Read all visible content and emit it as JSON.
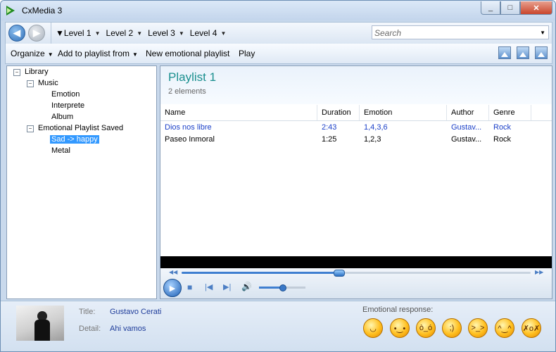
{
  "window": {
    "title": "CxMedia 3",
    "minimize": "_",
    "maximize": "□",
    "close": "✕"
  },
  "nav": {
    "back_icon": "◀",
    "forward_icon": "▶",
    "crumbs": [
      "Level 1",
      "Level 2",
      "Level 3",
      "Level 4"
    ],
    "search_placeholder": "Search"
  },
  "toolbar": {
    "organize": "Organize",
    "add_playlist": "Add to playlist from",
    "new_emotional": "New emotional playlist",
    "play": "Play"
  },
  "tree": {
    "library": "Library",
    "music": "Music",
    "emotion": "Emotion",
    "interprete": "Interprete",
    "album": "Album",
    "emotional_saved": "Emotional Playlist Saved",
    "sad_happy": "Sad -> happy",
    "metal": "Metal"
  },
  "playlist": {
    "title": "Playlist 1",
    "subtitle": "2 elements",
    "columns": [
      "Name",
      "Duration",
      "Emotion",
      "Author",
      "Genre"
    ],
    "rows": [
      {
        "name": "Dios nos libre",
        "duration": "2:43",
        "emotion": "1,4,3,6",
        "author": "Gustav...",
        "genre": "Rock"
      },
      {
        "name": "Paseo Inmoral",
        "duration": "1:25",
        "emotion": "1,2,3",
        "author": "Gustav...",
        "genre": "Rock"
      }
    ]
  },
  "player": {
    "play_icon": "▶",
    "stop_icon": "■",
    "prev_icon": "|◀",
    "next_icon": "▶|",
    "volume_icon": "🔊",
    "seek_progress": 0.45,
    "volume_level": 0.5
  },
  "footer": {
    "title_label": "Title:",
    "title_value": "Gustavo Cerati",
    "detail_label": "Detail:",
    "detail_value": "Ahi vamos",
    "emotional_label": "Emotional response:"
  },
  "colors": {
    "accent": "#1a8f8f",
    "link": "#1e3c9a",
    "selection": "#3399ff",
    "playing_row": "#1a3fc8"
  }
}
